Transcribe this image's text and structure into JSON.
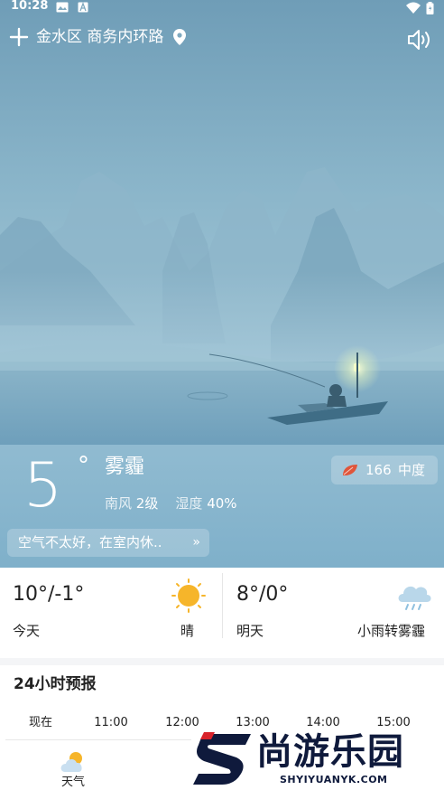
{
  "status_bar": {
    "time": "10:28",
    "icons": [
      "image-icon",
      "a-box-icon",
      "wifi-icon",
      "battery-icon"
    ]
  },
  "location_bar": {
    "add_icon": "plus-icon",
    "location": "金水区 商务内环路",
    "location_icon": "map-pin-icon",
    "sound_icon": "speaker-icon"
  },
  "current": {
    "temperature": "5",
    "degree": "°",
    "condition": "雾霾",
    "wind_label": "南风",
    "wind_value": "2级",
    "humidity_label": "湿度",
    "humidity_value": "40%",
    "aqi_value": "166",
    "aqi_level": "中度",
    "aqi_icon": "leaf-icon",
    "tip": "空气不太好，在室内休..",
    "tip_arrow": "»"
  },
  "forecast": {
    "today": {
      "temp": "10°/-1°",
      "label": "今天",
      "condition": "晴",
      "icon": "sun-icon"
    },
    "tomorrow": {
      "temp": "8°/0°",
      "label": "明天",
      "condition": "小雨转雾霾",
      "icon": "rain-cloud-icon"
    }
  },
  "hourly": {
    "title": "24小时预报",
    "hours": [
      "现在",
      "11:00",
      "12:00",
      "13:00",
      "14:00",
      "15:00"
    ],
    "row_label": "天气",
    "row_icon": "partly-cloudy-icon"
  },
  "watermark": {
    "cn": "尚游乐园",
    "en": "SHYIYUANYK.COM"
  },
  "colors": {
    "sky_top": "#6f9db7",
    "sky_bottom": "#8fbad0",
    "sun": "#f6b52a",
    "aqi_leaf": "#e0553a",
    "watermark": "#0f1a3c",
    "watermark_accent": "#d8222a"
  }
}
